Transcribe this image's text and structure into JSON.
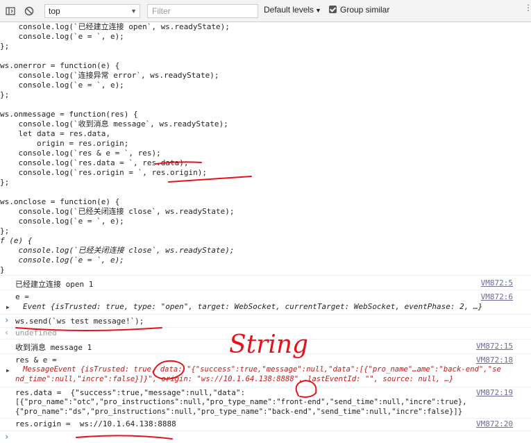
{
  "toolbar": {
    "context_value": "top",
    "filter_placeholder": "Filter",
    "levels_label": "Default levels",
    "group_label": "Group similar"
  },
  "code_lines": [
    "    console.log(`已经建立连接 open`, ws.readyState);",
    "    console.log(`e = `, e);",
    "};",
    "",
    "ws.onerror = function(e) {",
    "    console.log(`连接异常 error`, ws.readyState);",
    "    console.log(`e = `, e);",
    "};",
    "",
    "ws.onmessage = function(res) {",
    "    console.log(`收到消息 message`, ws.readyState);",
    "    let data = res.data,",
    "        origin = res.origin;",
    "    console.log(`res & e = `, res);",
    "    console.log(`res.data = `, res.data);",
    "    console.log(`res.origin = `, res.origin);",
    "};",
    "",
    "ws.onclose = function(e) {",
    "    console.log(`已经关闭连接 close`, ws.readyState);",
    "    console.log(`e = `, e);",
    "};",
    "f (e) {",
    "    console.log(`已经关闭连接 close`, ws.readyState);",
    "    console.log(`e = `, e);",
    "}"
  ],
  "messages": {
    "m1_text": "已经建立连接 open 1",
    "m1_link": "VM872:5",
    "m2_text": "e =",
    "m2_link": "VM872:6",
    "m2_obj": "Event {isTrusted: true, type: \"open\", target: WebSocket, currentTarget: WebSocket, eventPhase: 2, …}",
    "input_cmd": "ws.send(`ws test message!`);",
    "output_undefined": "undefined",
    "m3_text": "收到消息 message 1",
    "m3_link": "VM872:15",
    "m4_text": "res & e =",
    "m4_link": "VM872:18",
    "m4_obj_line1": "MessageEvent {isTrusted: true, data: \"{\"success\":true,\"message\":null,\"data\":[{\"pro_name\"…ame\":\"back-end\",\"se",
    "m4_obj_line2": "nd_time\":null,\"incre\":false}]}\", origin: \"ws://10.1.64.138:8888\", lastEventId: \"\", source: null, …}",
    "m5_line1": "res.data =  {\"success\":true,\"message\":null,\"data\":",
    "m5_line2": "[{\"pro_name\":\"otc\",\"pro_instructions\":null,\"pro_type_name\":\"front-end\",\"send_time\":null,\"incre\":true},",
    "m5_line3": "{\"pro_name\":\"ds\",\"pro_instructions\":null,\"pro_type_name\":\"back-end\",\"send_time\":null,\"incre\":false}]}",
    "m5_link": "VM872:19",
    "m6_text": "res.origin =  ws://10.1.64.138:8888",
    "m6_link": "VM872:20"
  },
  "annotation_text": "String",
  "colors": {
    "annotation": "#e8111a",
    "link": "#6b6b9e",
    "string": "#c41a16",
    "keyword": "#aa0d91"
  }
}
